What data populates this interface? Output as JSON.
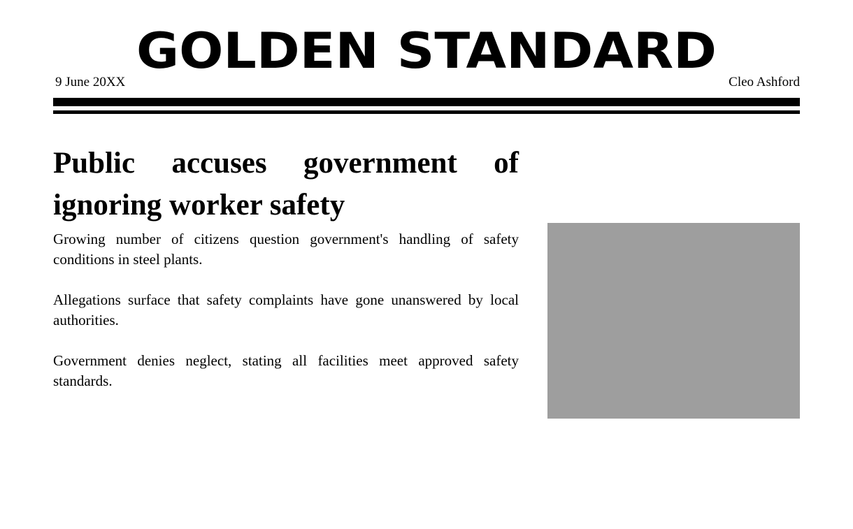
{
  "masthead": {
    "title": "GOLDEN STANDARD",
    "date": "9 June 20XX",
    "author": "Cleo Ashford"
  },
  "article": {
    "headline": "Public accuses government of ignoring worker safety",
    "paragraphs": [
      "Growing number of citizens question government's handling of safety conditions in steel plants.",
      "Allegations surface that safety complaints have gone unanswered by local authorities.",
      "Government denies neglect, stating all facilities meet approved safety standards."
    ]
  },
  "image": {
    "placeholder_color": "#9e9e9e"
  }
}
